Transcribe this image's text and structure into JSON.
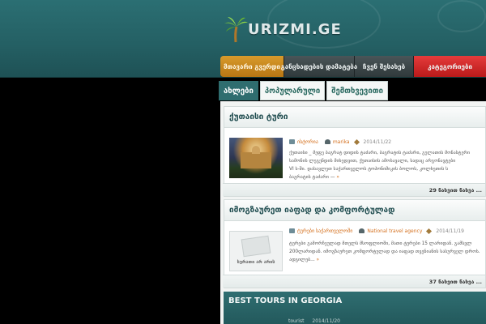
{
  "logo": {
    "text": "URIZMI.GE",
    "icon": "palm-tree-icon"
  },
  "nav": {
    "items": [
      {
        "label": "მთავარი გვერდი",
        "state": "active"
      },
      {
        "label": "განცხადების დამატება",
        "state": "normal"
      },
      {
        "label": "ჩვენ შესახებ",
        "state": "normal"
      },
      {
        "label": "კატეგორიები",
        "state": "highlight"
      }
    ]
  },
  "tabs": [
    {
      "label": "ახლები",
      "active": true
    },
    {
      "label": "პოპულარული",
      "active": false
    },
    {
      "label": "შემთხვევითი",
      "active": false
    }
  ],
  "posts": [
    {
      "title": "ქუთაისი ტური",
      "category": "ისტორია",
      "author": "marika",
      "date": "2014/11/22",
      "excerpt_lines": [
        "ქუთაისი _ მეფე ბაგრატ დიდის ტაძარი, ბაგრატის ტაძარი, გელათის მონასტერი",
        "სამონის ლეგენდის მიხედვით, ქუთაისის ამოსავალი, სადაც არგონავტები",
        "VI ს-ში. დასავლეთ საქართველოს ტოპონიმიკის ბოლოს, კოლხეთის ს",
        "ბაგრატის ტაძარი —"
      ],
      "more": "»",
      "views": "29 ნახვით ნახვა ..."
    },
    {
      "title": "იმოგზაურეთ იაფად და კომფორტულად",
      "category": "ტურები საქართველოში",
      "author": "National travel agency",
      "date": "2014/11/19",
      "excerpt_lines": [
        "ტურები გამორჩეულად მთელს მსოფლიოში, მათი ტურები 15 ლარიდან. გამსვლ",
        "200ლარიდან. იმოგზაურეთ კომფორტულად და იაფად თვენიანის სასურველ დროს.",
        "ადგილებ..."
      ],
      "more": "»",
      "no_image": "სურათი არ არის",
      "views": "37 ნახვით ნახვა ..."
    },
    {
      "title": "BEST TOURS IN GEORGIA",
      "category": "",
      "author": "tourist",
      "date": "2014/11/20"
    }
  ],
  "colors": {
    "header_bg": "#245f63",
    "nav_active": "#d89a2b",
    "nav_highlight": "#e53b3b",
    "link_orange": "#d4701e",
    "title_teal": "#1f4c4f"
  }
}
